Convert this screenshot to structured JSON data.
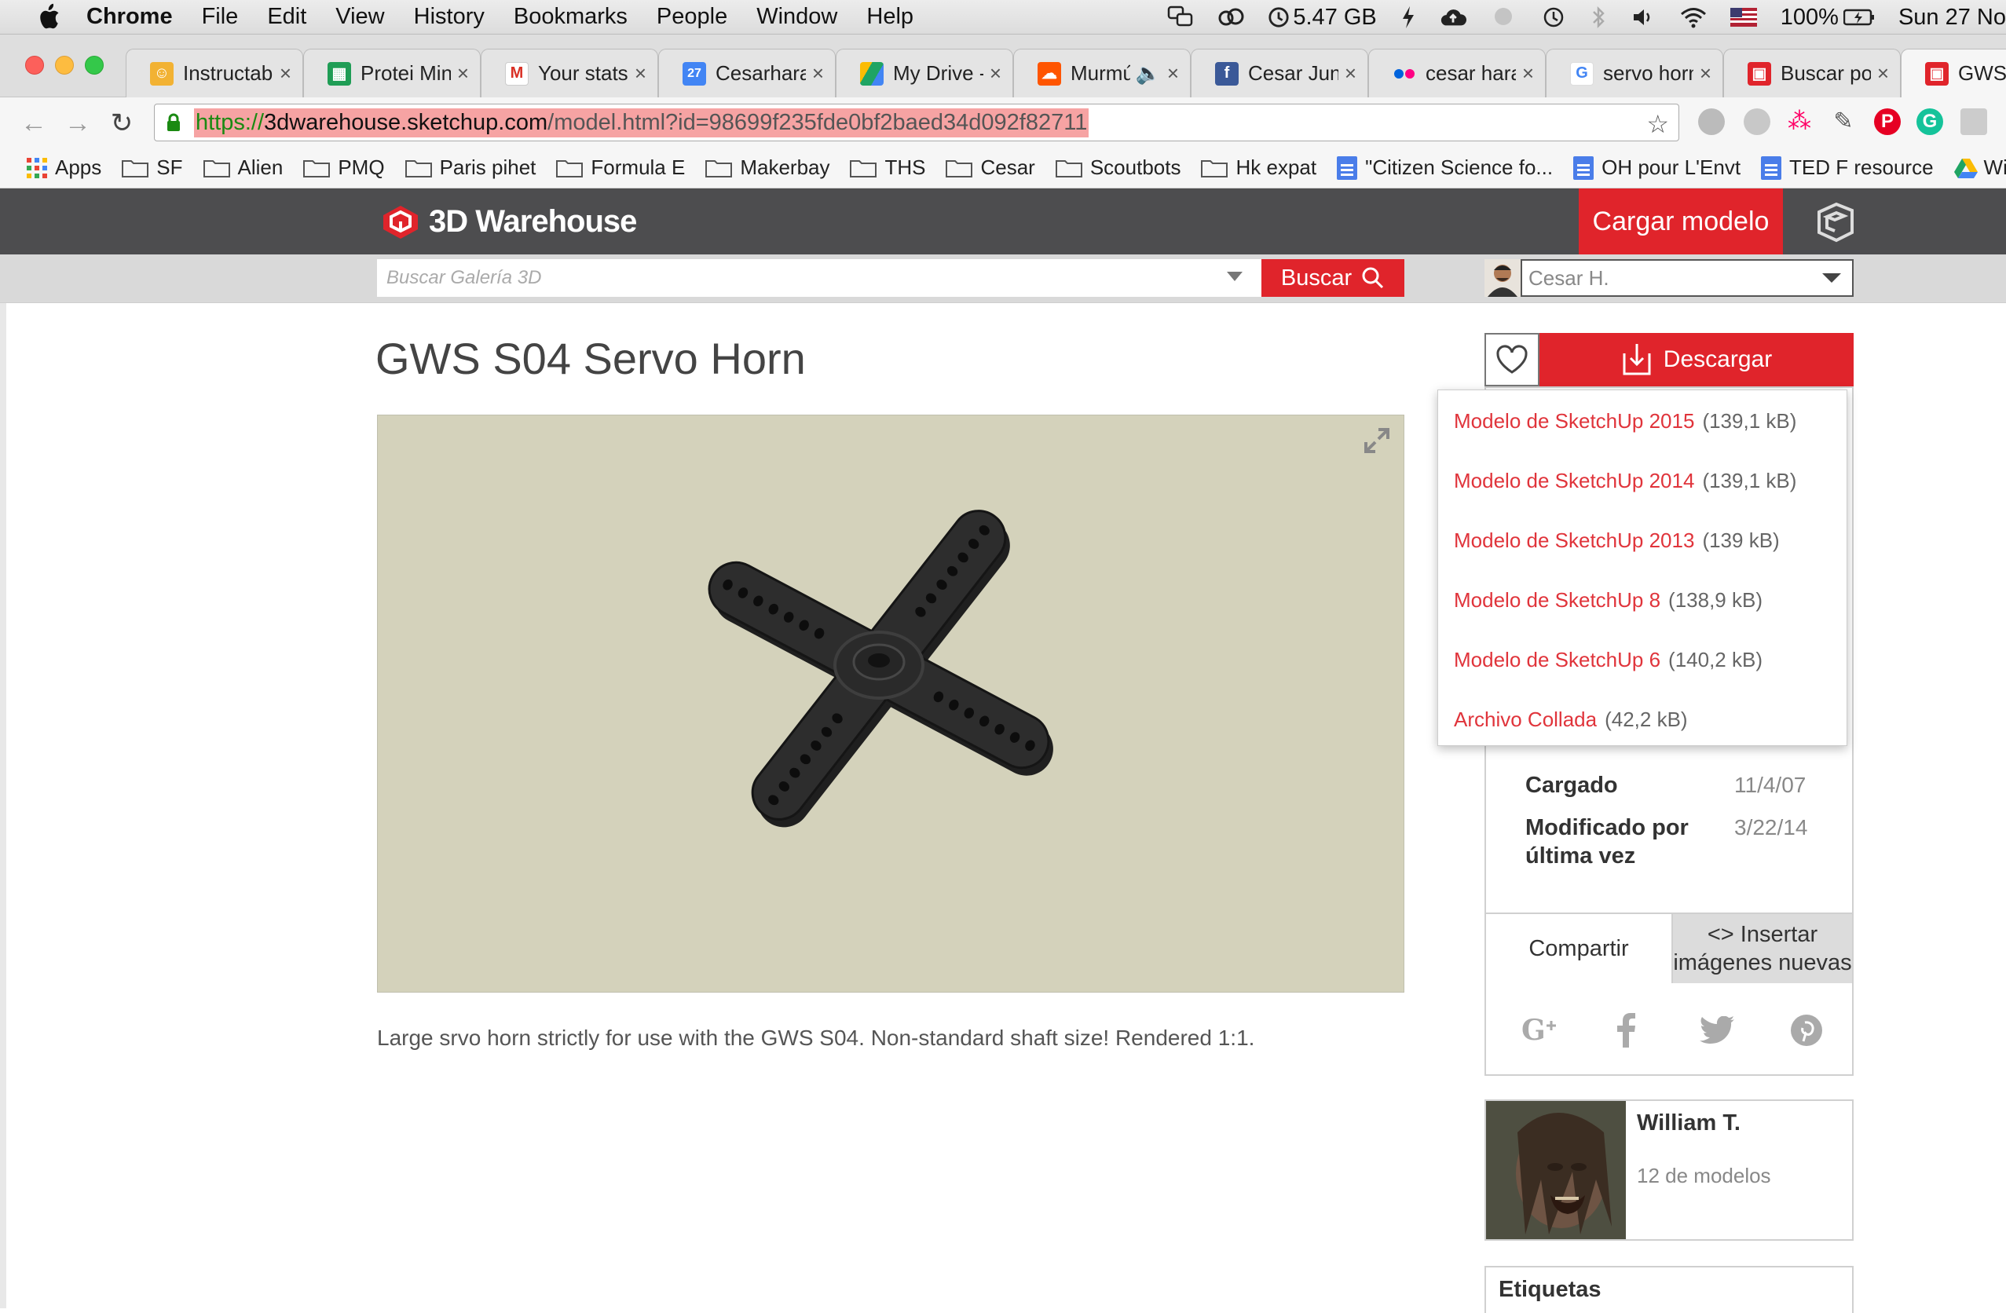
{
  "menubar": {
    "app": "Chrome",
    "items": [
      "File",
      "Edit",
      "View",
      "History",
      "Bookmarks",
      "People",
      "Window",
      "Help"
    ],
    "memory": "5.47 GB",
    "battery": "100%",
    "clock": "Sun 27 No"
  },
  "tabs": [
    {
      "title": "Instructab",
      "favicon_color": "#f2b233"
    },
    {
      "title": "Protei Min",
      "favicon_color": "#1f9d55"
    },
    {
      "title": "Your stats",
      "favicon_color": "#d93025"
    },
    {
      "title": "Cesarhara",
      "favicon_color": "#4285f4"
    },
    {
      "title": "My Drive -",
      "favicon_color": "#1fa463"
    },
    {
      "title": "Murmúr",
      "favicon_color": "#ff5500"
    },
    {
      "title": "Cesar Jun",
      "favicon_color": "#3b5998"
    },
    {
      "title": "cesar hara",
      "favicon_color": "#ff0084"
    },
    {
      "title": "servo horn",
      "favicon_color": "#4285f4"
    },
    {
      "title": "Buscar po",
      "favicon_color": "#e0242b"
    },
    {
      "title": "GWS",
      "favicon_color": "#e0242b"
    }
  ],
  "url": {
    "scheme": "https://",
    "host": "3dwarehouse.sketchup.com",
    "path": "/model.html?id=98699f235fde0bf2baed34d092f82711"
  },
  "bookmarks": [
    {
      "label": "Apps",
      "kind": "apps"
    },
    {
      "label": "SF",
      "kind": "folder"
    },
    {
      "label": "Alien",
      "kind": "folder"
    },
    {
      "label": "PMQ",
      "kind": "folder"
    },
    {
      "label": "Paris pihet",
      "kind": "folder"
    },
    {
      "label": "Formula E",
      "kind": "folder"
    },
    {
      "label": "Makerbay",
      "kind": "folder"
    },
    {
      "label": "THS",
      "kind": "folder"
    },
    {
      "label": "Cesar",
      "kind": "folder"
    },
    {
      "label": "Scoutbots",
      "kind": "folder"
    },
    {
      "label": "Hk expat",
      "kind": "folder"
    },
    {
      "label": "\"Citizen Science fo...",
      "kind": "doc"
    },
    {
      "label": "OH pour L'Envt",
      "kind": "doc"
    },
    {
      "label": "TED F resource",
      "kind": "doc"
    },
    {
      "label": "Win",
      "kind": "drive"
    }
  ],
  "site": {
    "logo_text": "3D Warehouse",
    "upload_label": "Cargar modelo",
    "search_placeholder": "Buscar Galería 3D",
    "search_button": "Buscar",
    "user_name": "Cesar H."
  },
  "model": {
    "title": "GWS S04 Servo Horn",
    "description": "Large srvo horn strictly for use with the GWS S04. Non-standard shaft size! Rendered 1:1."
  },
  "download": {
    "label": "Descargar",
    "options": [
      {
        "name": "Modelo de SketchUp 2015",
        "size": "(139,1 kB)"
      },
      {
        "name": "Modelo de SketchUp 2014",
        "size": "(139,1 kB)"
      },
      {
        "name": "Modelo de SketchUp 2013",
        "size": "(139 kB)"
      },
      {
        "name": "Modelo de SketchUp 8",
        "size": "(138,9 kB)"
      },
      {
        "name": "Modelo de SketchUp 6",
        "size": "(140,2 kB)"
      },
      {
        "name": "Archivo Collada",
        "size": "(42,2 kB)"
      }
    ]
  },
  "meta": {
    "uploaded_label": "Cargado",
    "uploaded_value": "11/4/07",
    "modified_label_1": "Modificado por",
    "modified_label_2": "última vez",
    "modified_value": "3/22/14"
  },
  "share": {
    "share_label": "Compartir",
    "embed_label_1": "<> Insertar",
    "embed_label_2": "imágenes nuevas",
    "networks": [
      "google-plus",
      "facebook",
      "twitter",
      "pinterest"
    ]
  },
  "author": {
    "name": "William T.",
    "models": "12 de modelos"
  },
  "tags": {
    "label": "Etiquetas"
  },
  "colors": {
    "brand_red": "#e0242b",
    "header_gray": "#4d4d4f",
    "viewer_bg": "#d4d2bb"
  }
}
